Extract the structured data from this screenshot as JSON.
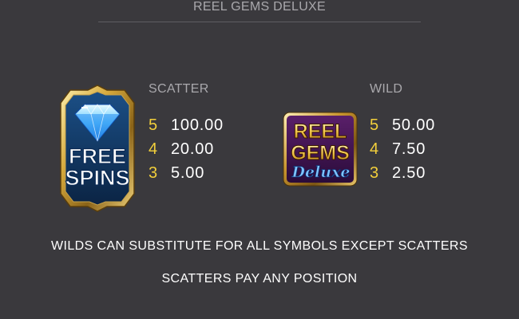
{
  "header": {
    "title": "REEL GEMS DELUXE"
  },
  "scatter": {
    "name": "SCATTER",
    "icon": "free-spins-diamond-icon",
    "icon_text": [
      "FREE",
      "SPINS"
    ],
    "pays": [
      {
        "count": "5",
        "value": "100.00"
      },
      {
        "count": "4",
        "value": "20.00"
      },
      {
        "count": "3",
        "value": "5.00"
      }
    ]
  },
  "wild": {
    "name": "WILD",
    "icon": "reel-gems-deluxe-logo-icon",
    "icon_text": [
      "REEL",
      "GEMS",
      "Deluxe"
    ],
    "pays": [
      {
        "count": "5",
        "value": "50.00"
      },
      {
        "count": "4",
        "value": "7.50"
      },
      {
        "count": "3",
        "value": "2.50"
      }
    ]
  },
  "rules": [
    "WILDS CAN SUBSTITUTE FOR ALL SYMBOLS EXCEPT SCATTERS",
    "SCATTERS PAY ANY POSITION"
  ],
  "colors": {
    "background": "#3a393d",
    "count_yellow": "#f2cf3b",
    "muted_text": "#a9a8ac"
  }
}
